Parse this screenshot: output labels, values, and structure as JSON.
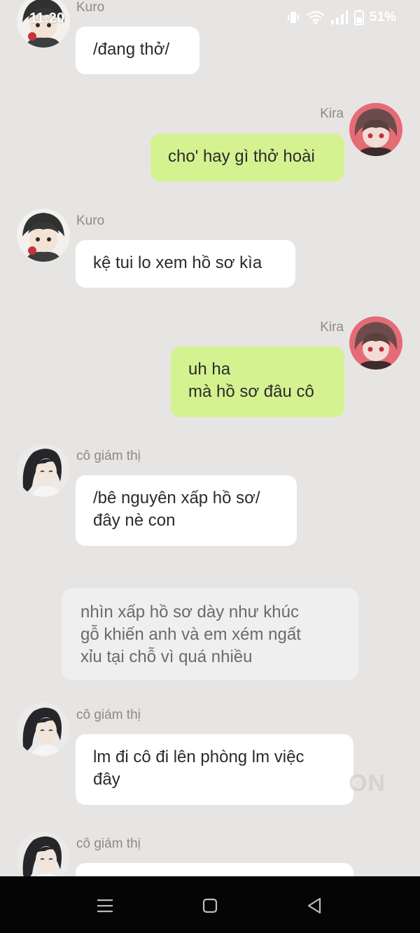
{
  "status_bar": {
    "time": "11:20",
    "battery_percent": "51%",
    "icons": [
      "vibrate-icon",
      "wifi-icon",
      "signal-icon",
      "battery-icon"
    ]
  },
  "messages": [
    {
      "sender": "Kuro",
      "side": "left",
      "style": "white",
      "text": "/đang thở/"
    },
    {
      "sender": "Kira",
      "side": "right",
      "style": "green",
      "text": "cho' hay gì thở hoài"
    },
    {
      "sender": "Kuro",
      "side": "left",
      "style": "white",
      "text": "kệ tui lo xem hồ sơ kìa"
    },
    {
      "sender": "Kira",
      "side": "right",
      "style": "green",
      "text": "uh ha\nmà hồ sơ đâu cô"
    },
    {
      "sender": "cô giám thị",
      "side": "left",
      "style": "white",
      "text": "/bê nguyên xấp hồ sơ/\nđây nè con"
    },
    {
      "sender": "",
      "side": "center",
      "style": "narration",
      "text": "nhìn xấp hồ sơ dày như khúc\ngỗ khiến anh và em xém ngất\nxỉu tại chỗ vì quá nhiều"
    },
    {
      "sender": "cô giám thị",
      "side": "left",
      "style": "white",
      "text": "lm đi cô đi lên phòng lm việc\nđây"
    },
    {
      "sender": "cô giám thị",
      "side": "left",
      "style": "white",
      "text": ""
    }
  ],
  "watermark": "ON",
  "nav_bar": {
    "buttons": [
      "recents-icon",
      "home-icon",
      "back-icon"
    ]
  },
  "colors": {
    "background": "#e7e5e3",
    "bubble_white": "#ffffff",
    "bubble_green": "#d5f290",
    "narration": "#efeff0",
    "navbar": "#050505"
  }
}
